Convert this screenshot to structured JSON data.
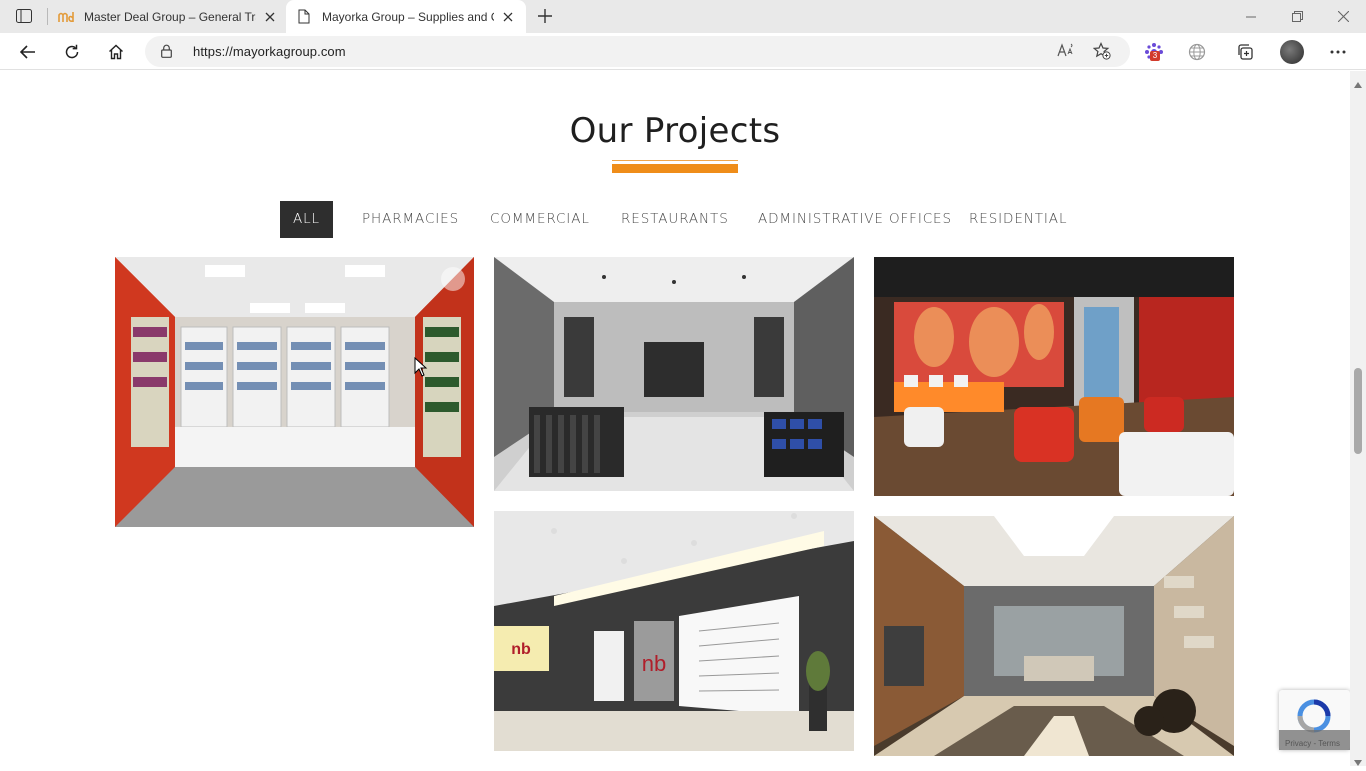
{
  "browser": {
    "tabs": [
      {
        "title": "Master Deal Group – General Tra",
        "favicon": "md-logo-icon"
      },
      {
        "title": "Mayorka Group – Supplies and C",
        "favicon": "page-icon"
      }
    ],
    "url": "https://mayorkagroup.com",
    "extension_badge": "3"
  },
  "page": {
    "section_title": "Our Projects",
    "filters": [
      {
        "label": "ALL",
        "active": true
      },
      {
        "label": "PHARMACIES",
        "active": false
      },
      {
        "label": "COMMERCIAL",
        "active": false
      },
      {
        "label": "RESTAURANTS",
        "active": false
      },
      {
        "label": "ADMINISTRATIVE OFFICES",
        "active": false
      },
      {
        "label": "RESIDENTIAL",
        "active": false
      }
    ],
    "projects": [
      {
        "name": "pharmacy-interior"
      },
      {
        "name": "clothing-store-interior"
      },
      {
        "name": "restaurant-lounge-interior"
      },
      {
        "name": "newborn-office-interior"
      },
      {
        "name": "residential-living-interior"
      }
    ],
    "recaptcha": {
      "label": "Privacy - Terms"
    }
  },
  "colors": {
    "accent": "#ef8d19",
    "active_filter_bg": "#2e2e2e",
    "title_text": "#1f1f1f"
  }
}
